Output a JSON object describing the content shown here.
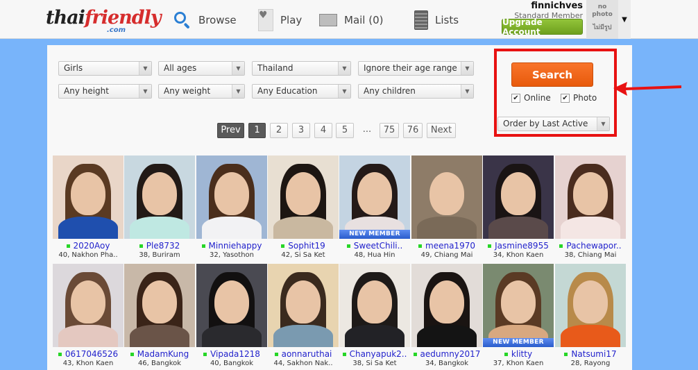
{
  "header": {
    "logo": {
      "part1": "thai",
      "part2": "friendly",
      "suffix": ".com"
    },
    "nav": [
      {
        "label": "Browse",
        "icon": "search-icon"
      },
      {
        "label": "Play",
        "icon": "playing-card-icon"
      },
      {
        "label": "Mail (0)",
        "icon": "mail-icon"
      },
      {
        "label": "Lists",
        "icon": "notepad-icon"
      }
    ],
    "user": {
      "username": "finnichves",
      "member_type": "Standard Member",
      "upgrade_label": "Upgrade Account",
      "avatar_text_1": "no",
      "avatar_text_2": "photo",
      "avatar_text_thai": "ไม่มีรูป",
      "menu_glyph": "▼"
    }
  },
  "filters": {
    "row1": [
      "Girls",
      "All ages",
      "Thailand",
      "Ignore their age range"
    ],
    "row2": [
      "Any height",
      "Any weight",
      "Any Education",
      "Any children"
    ],
    "arrow_glyph": "▼"
  },
  "pagination": {
    "prev": "Prev",
    "pages": [
      "1",
      "2",
      "3",
      "4",
      "5"
    ],
    "ellipsis": "...",
    "last_pages": [
      "75",
      "76"
    ],
    "next": "Next",
    "current": "1"
  },
  "search_panel": {
    "search_label": "Search",
    "online_label": "Online",
    "online_checked": true,
    "photo_label": "Photo",
    "photo_checked": true,
    "check_glyph": "✔",
    "order_by": "Order by Last Active"
  },
  "profiles": [
    {
      "name": "2020Aoy",
      "info": "40, Nakhon Pha..",
      "new": false,
      "bg": "#e9d6c8",
      "hair": "#5a3a22",
      "body": "#1f4fae"
    },
    {
      "name": "Ple8732",
      "info": "38, Buriram",
      "new": false,
      "bg": "#c8d8e0",
      "hair": "#221a16",
      "body": "#bfe8e2"
    },
    {
      "name": "Minniehappy",
      "info": "32, Yasothon",
      "new": false,
      "bg": "#9fb6d4",
      "hair": "#4a2e1c",
      "body": "#f2f2f4"
    },
    {
      "name": "Sophit19",
      "info": "42, Si Sa Ket",
      "new": false,
      "bg": "#e8dfd2",
      "hair": "#1d1612",
      "body": "#c9b8a0"
    },
    {
      "name": "SweetChili..",
      "info": "48, Hua Hin",
      "new": true,
      "bg": "#c4d4e2",
      "hair": "#241a18",
      "body": "#e8e0e0"
    },
    {
      "name": "meena1970",
      "info": "49, Chiang Mai",
      "new": false,
      "bg": "#8e7c68",
      "hair": "#8e7c68",
      "body": "#7a6a58"
    },
    {
      "name": "Jasmine8955",
      "info": "34, Khon Kaen",
      "new": false,
      "bg": "#3a3448",
      "hair": "#1a1414",
      "body": "#5a4a4a"
    },
    {
      "name": "Pachewapor..",
      "info": "38, Chiang Mai",
      "new": false,
      "bg": "#e6d2d0",
      "hair": "#4a2c1e",
      "body": "#f4e6e4"
    },
    {
      "name": "0617046526",
      "info": "43, Khon Kaen",
      "new": false,
      "bg": "#dcd8dc",
      "hair": "#6a4a36",
      "body": "#e4c8c0"
    },
    {
      "name": "MadamKung",
      "info": "46, Bangkok",
      "new": false,
      "bg": "#c8b8a8",
      "hair": "#3a2418",
      "body": "#6a5448"
    },
    {
      "name": "Vipada1218",
      "info": "40, Bangkok",
      "new": false,
      "bg": "#4a4a52",
      "hair": "#121010",
      "body": "#2a2a2e"
    },
    {
      "name": "aonnaruthai",
      "info": "44, Sakhon Nak..",
      "new": false,
      "bg": "#e8d4b0",
      "hair": "#3a2a1e",
      "body": "#7a9ab0"
    },
    {
      "name": "Chanyapuk2..",
      "info": "38, Si Sa Ket",
      "new": false,
      "bg": "#ece8e2",
      "hair": "#1e1a18",
      "body": "#222226"
    },
    {
      "name": "aedumny2017",
      "info": "34, Bangkok",
      "new": false,
      "bg": "#e2dcd8",
      "hair": "#1a1412",
      "body": "#141414"
    },
    {
      "name": "klitty",
      "info": "37, Khon Kaen",
      "new": true,
      "bg": "#7a8a70",
      "hair": "#5a3a24",
      "body": "#d8a880"
    },
    {
      "name": "Natsumi17",
      "info": "28, Rayong",
      "new": false,
      "bg": "#c4d8d4",
      "hair": "#b88a4a",
      "body": "#e85a1a"
    }
  ],
  "badge_label": "NEW MEMBER",
  "colors": {
    "background": "#78b4fa",
    "search_button": "#f26a1b",
    "upgrade_button": "#7fb22b",
    "username_link": "#2222cc",
    "online_dot": "#27d627",
    "highlight_box": "#e81212"
  }
}
